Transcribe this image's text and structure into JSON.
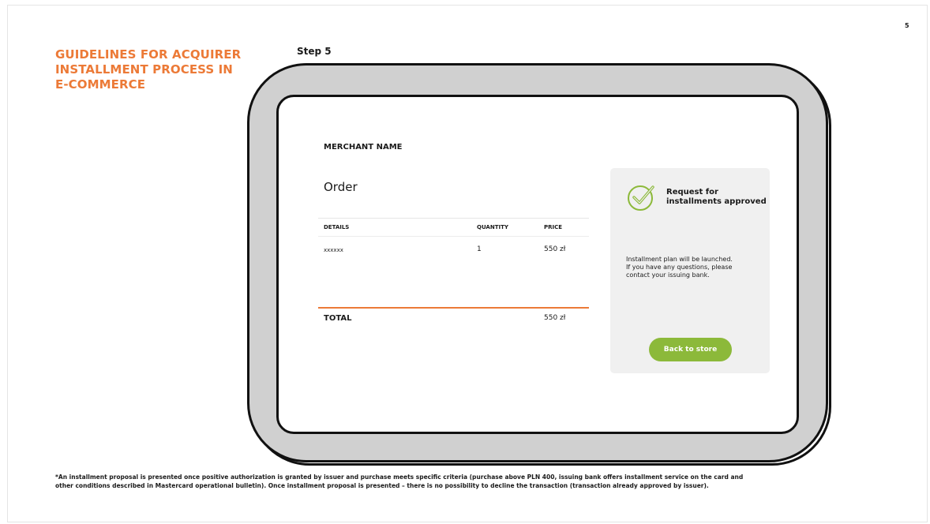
{
  "page_number": "5",
  "title": "GUIDELINES FOR ACQUIRER\nINSTALLMENT PROCESS IN\nE-COMMERCE",
  "step_label": "Step 5",
  "checkout": {
    "merchant_name": "MERCHANT NAME",
    "heading": "Order",
    "columns": {
      "details": "DETAILS",
      "quantity": "QUANTITY",
      "price": "PRICE"
    },
    "rows": [
      {
        "details": "xxxxxx",
        "quantity": "1",
        "price": "550 zł"
      }
    ],
    "total_label": "TOTAL",
    "total_value": "550 zł"
  },
  "approval_panel": {
    "icon": "check-circle-icon",
    "title": "Request for\ninstallments approved",
    "message": "Installment plan will be launched.\nIf you have any questions, please\ncontact your issuing bank.",
    "button_label": "Back to store"
  },
  "colors": {
    "accent_orange": "#ec7a37",
    "button_green": "#8cb93a",
    "panel_gray": "#f0f0f0",
    "device_gray": "#d0d0d0"
  },
  "footnote": "*An installment proposal is presented once positive authorization is granted by issuer and purchase meets specific criteria (purchase above PLN 400, issuing bank offers installment service on the card and\nother conditions described in Mastercard operational bulletin). Once installment proposal is presented – there is no possibility to decline the transaction (transaction already approved by issuer)."
}
